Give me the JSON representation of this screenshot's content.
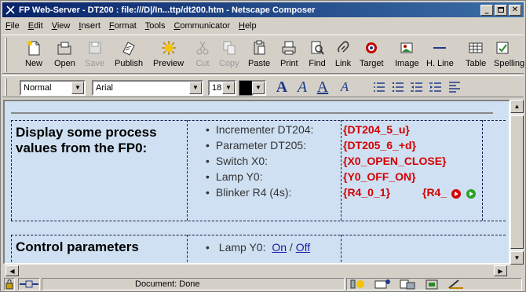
{
  "window": {
    "title": "FP Web-Server - DT200 : file:///D|/In...ttp/dt200.htm - Netscape Composer"
  },
  "menu": [
    "File",
    "Edit",
    "View",
    "Insert",
    "Format",
    "Tools",
    "Communicator",
    "Help"
  ],
  "toolbar": {
    "buttons": [
      {
        "label": "New",
        "icon": "new-page-icon",
        "enabled": true
      },
      {
        "label": "Open",
        "icon": "open-folder-icon",
        "enabled": true
      },
      {
        "label": "Save",
        "icon": "save-disk-icon",
        "enabled": false
      },
      {
        "label": "Publish",
        "icon": "publish-icon",
        "enabled": true
      },
      {
        "label": "Preview",
        "icon": "preview-icon",
        "enabled": true
      },
      {
        "label": "Cut",
        "icon": "cut-icon",
        "enabled": false
      },
      {
        "label": "Copy",
        "icon": "copy-icon",
        "enabled": false
      },
      {
        "label": "Paste",
        "icon": "paste-icon",
        "enabled": true
      },
      {
        "label": "Print",
        "icon": "print-icon",
        "enabled": true
      },
      {
        "label": "Find",
        "icon": "find-icon",
        "enabled": true
      },
      {
        "label": "Link",
        "icon": "link-icon",
        "enabled": true
      },
      {
        "label": "Target",
        "icon": "target-icon",
        "enabled": true
      },
      {
        "label": "Image",
        "icon": "image-icon",
        "enabled": true
      },
      {
        "label": "H. Line",
        "icon": "hline-icon",
        "enabled": true
      },
      {
        "label": "Table",
        "icon": "table-icon",
        "enabled": true
      },
      {
        "label": "Spelling",
        "icon": "spelling-icon",
        "enabled": true
      }
    ]
  },
  "format": {
    "paragraph_style": "Normal",
    "font": "Arial",
    "font_size": "18"
  },
  "page": {
    "section1_heading": "Display some process values from the FP0:",
    "section2_heading": "Control parameters",
    "items": [
      {
        "label": "Incrementer DT204:",
        "value": "{DT204_5_u}"
      },
      {
        "label": "Parameter  DT205:",
        "value": "{DT205_6_+d}"
      },
      {
        "label": "Switch X0:",
        "value": "{X0_OPEN_CLOSE}"
      },
      {
        "label": "Lamp  Y0:",
        "value": "{Y0_OFF_ON}"
      },
      {
        "label": "Blinker R4 (4s):",
        "value": "{R4_0_1}",
        "value2": "{R4_"
      }
    ],
    "control": {
      "label": "Lamp Y0:",
      "on": "On",
      "sep": " / ",
      "off": "Off"
    }
  },
  "status": {
    "text": "Document: Done"
  },
  "colors": {
    "title_bar": "#0a246a",
    "value_text": "#d40000",
    "page_bg": "#cfe0f2",
    "link": "#1a1aa8"
  }
}
